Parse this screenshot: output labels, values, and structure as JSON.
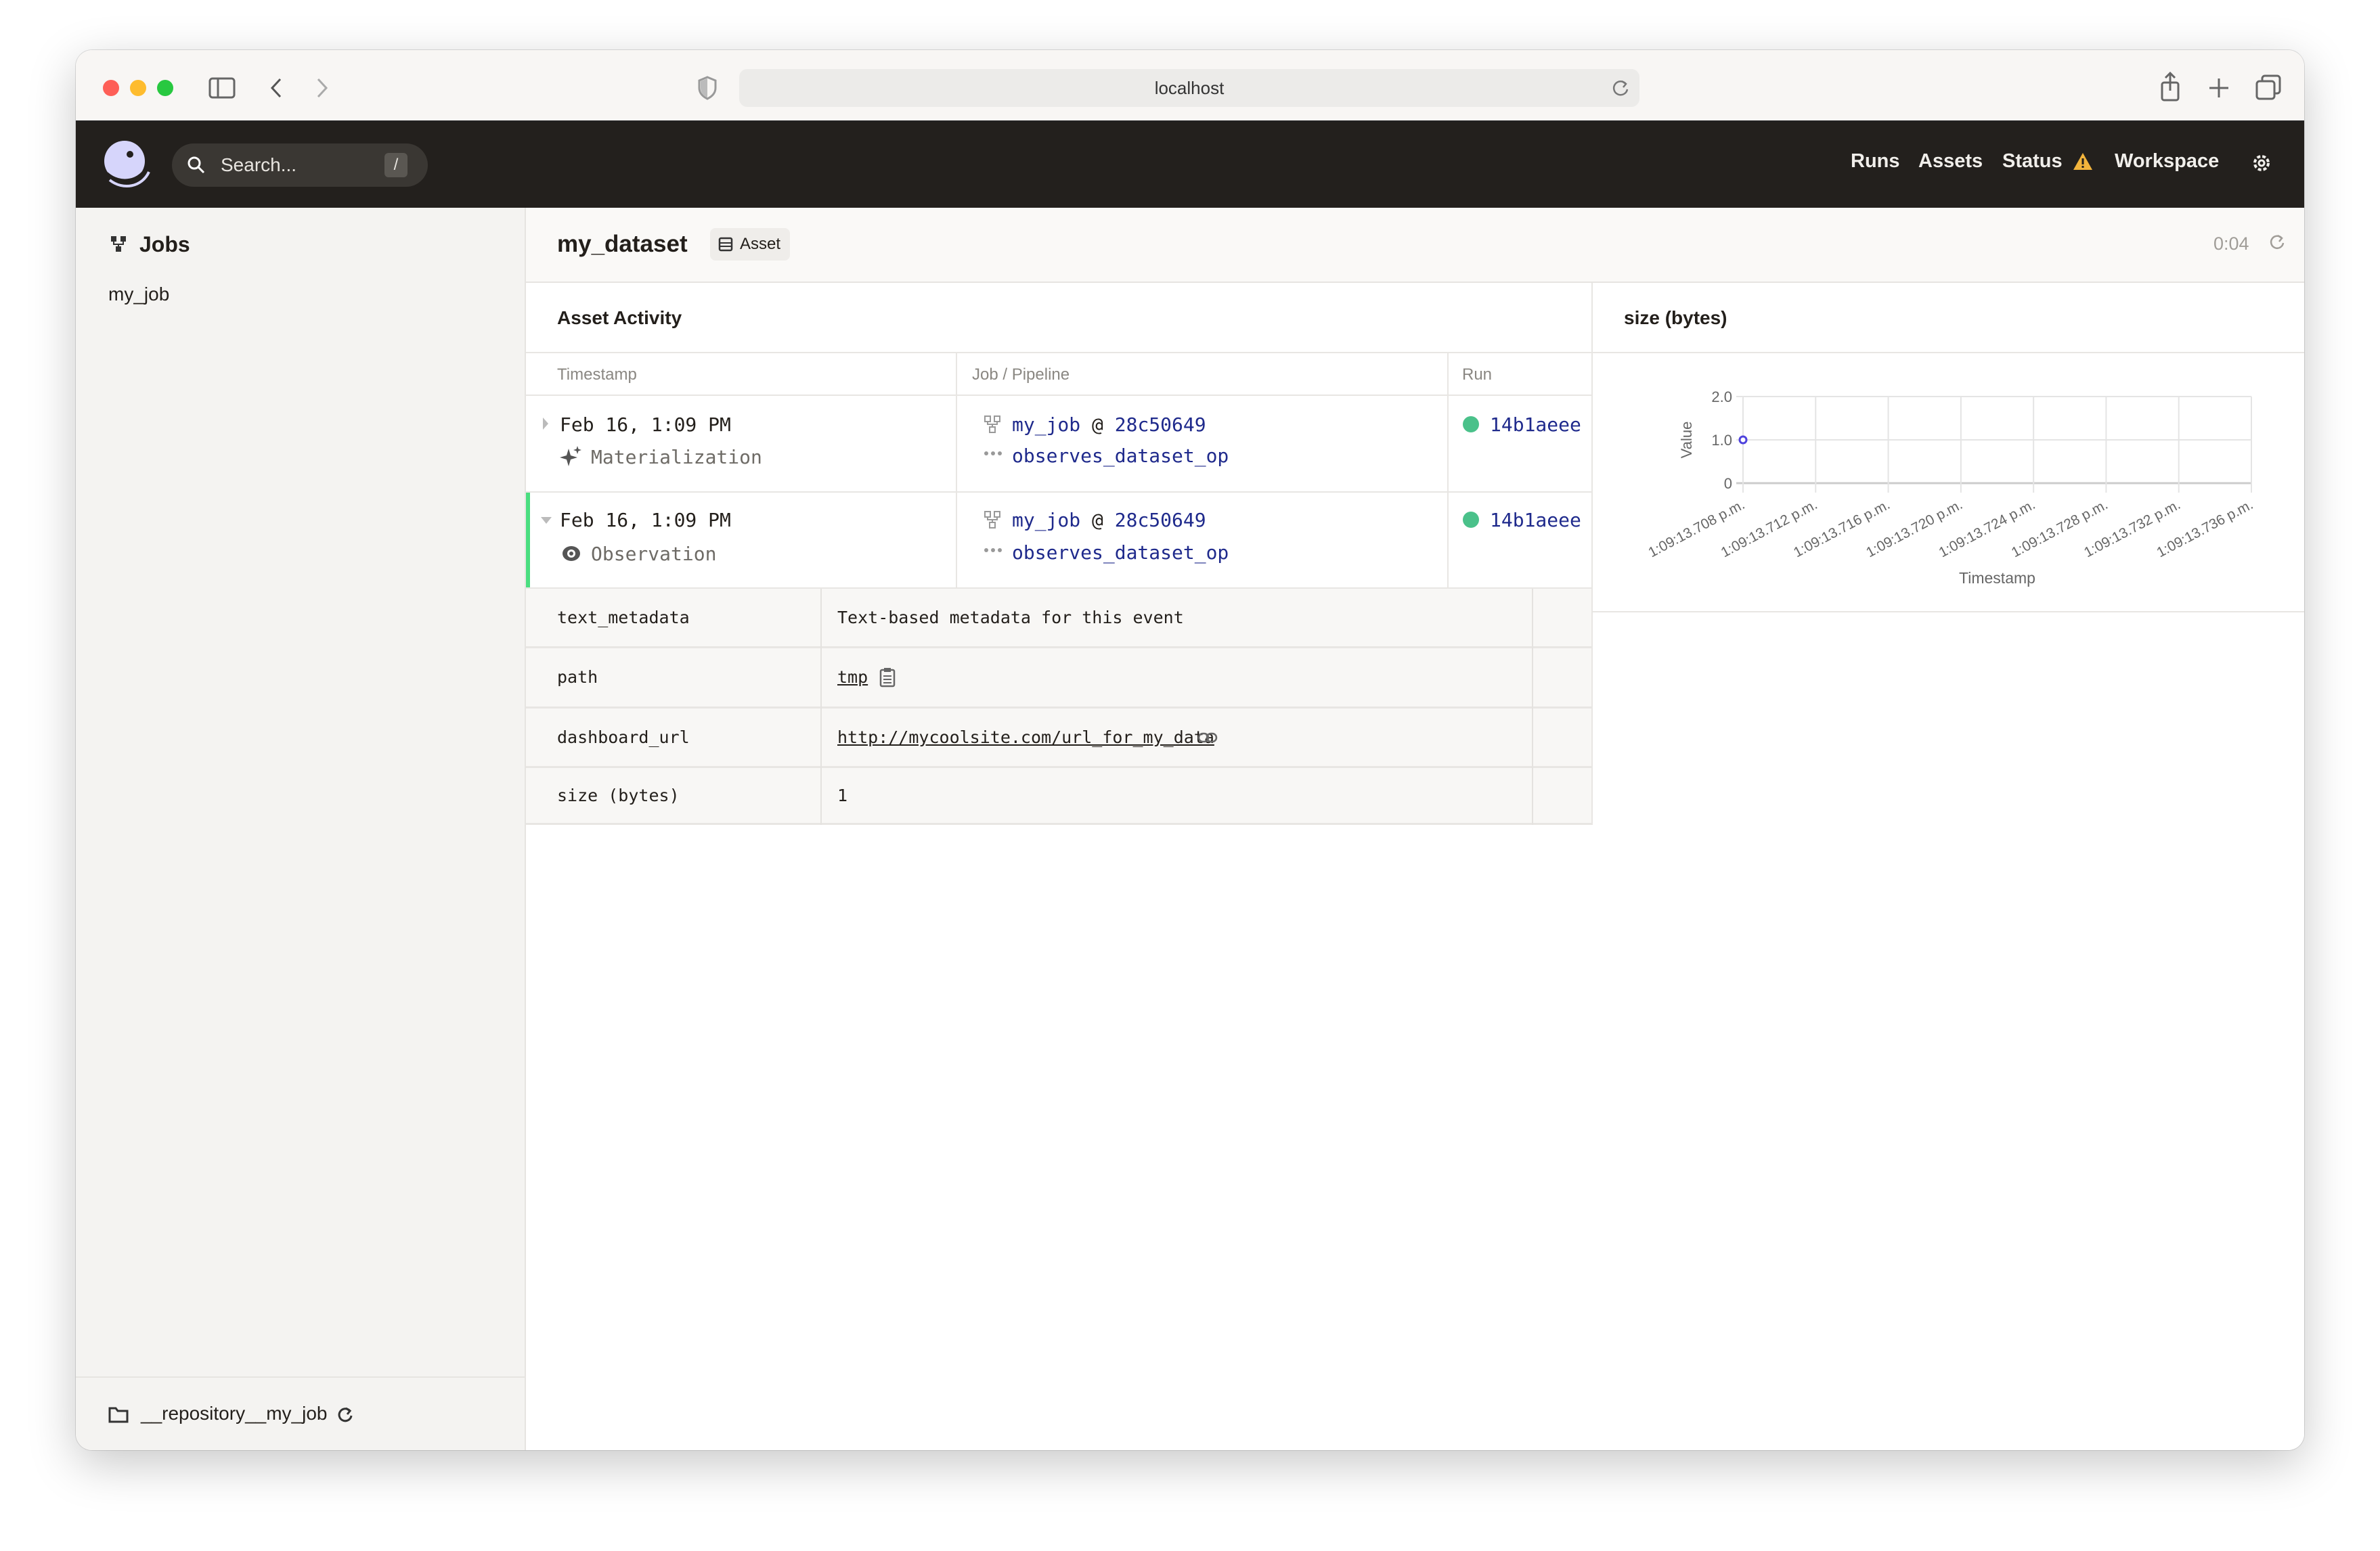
{
  "browser": {
    "url": "localhost"
  },
  "topnav": {
    "search_placeholder": "Search...",
    "search_shortcut": "/",
    "links": [
      "Runs",
      "Assets",
      "Status",
      "Workspace"
    ],
    "status_color": "#f2b43c"
  },
  "sidebar": {
    "section_title": "Jobs",
    "items": [
      "my_job"
    ],
    "footer_repo": "__repository__my_job"
  },
  "header": {
    "title": "my_dataset",
    "badge": "Asset",
    "refresh_timer": "0:04"
  },
  "activity": {
    "title": "Asset Activity",
    "columns": [
      "Timestamp",
      "Job / Pipeline",
      "Run"
    ],
    "rows": [
      {
        "timestamp": "Feb 16, 1:09 PM",
        "type": "Materialization",
        "job": "my_job",
        "at": "@",
        "snapshot": "28c50649",
        "op": "observes_dataset_op",
        "run": "14b1aeee",
        "run_status_color": "#4ac18a",
        "expanded": false
      },
      {
        "timestamp": "Feb 16, 1:09 PM",
        "type": "Observation",
        "job": "my_job",
        "at": "@",
        "snapshot": "28c50649",
        "op": "observes_dataset_op",
        "run": "14b1aeee",
        "run_status_color": "#4ac18a",
        "expanded": true
      }
    ],
    "metadata": [
      {
        "key": "text_metadata",
        "value": "Text-based metadata for this event"
      },
      {
        "key": "path",
        "value": "tmp"
      },
      {
        "key": "dashboard_url",
        "value": "http://mycoolsite.com/url_for_my_data"
      },
      {
        "key": "size (bytes)",
        "value": "1"
      }
    ]
  },
  "chart_panel": {
    "title": "size (bytes)"
  },
  "chart_data": {
    "type": "scatter",
    "xlabel": "Timestamp",
    "ylabel": "Value",
    "x_tick_labels": [
      "1:09:13.708 p.m.",
      "1:09:13.712 p.m.",
      "1:09:13.716 p.m.",
      "1:09:13.720 p.m.",
      "1:09:13.724 p.m.",
      "1:09:13.728 p.m.",
      "1:09:13.732 p.m.",
      "1:09:13.736 p.m."
    ],
    "y_tick_labels": [
      "0",
      "1.0",
      "2.0"
    ],
    "ylim": [
      0,
      2
    ],
    "points": [
      {
        "x": "1:09:13.708 p.m.",
        "y": 1
      }
    ],
    "point_color": "#4f43dd",
    "grid": true
  }
}
